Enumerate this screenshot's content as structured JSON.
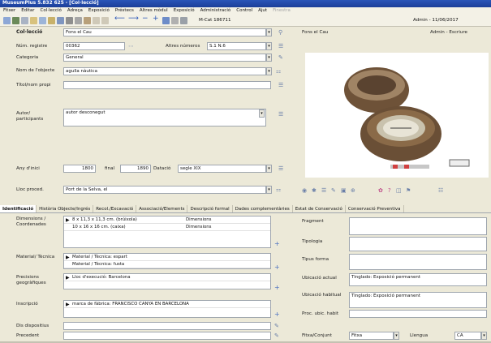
{
  "window": {
    "title": "MuseumPlus 5.832 625 - [Col·lecció]"
  },
  "menu": [
    "Fitxer",
    "Editar",
    "Col·lecció",
    "Adreça",
    "Exposició",
    "Préstecs",
    "Altres mòdul",
    "Exposició",
    "Administració",
    "Control",
    "Ajut"
  ],
  "menu_dim": "Finestra",
  "toolbar": {
    "record": "M-Cat 186711",
    "user_date": "Admin - 11/06/2017"
  },
  "header": {
    "label": "Col·lecció",
    "collection": "Fons el Cau",
    "right_collection": "Fons el Cau",
    "right_user": "Admin - Escriure"
  },
  "fields": {
    "num_registre_label": "Núm. registre",
    "num_registre": "00362",
    "altres_numeros_label": "Altres números",
    "altres_numeros": "S.1 N.6",
    "categoria_label": "Categoria",
    "categoria": "General",
    "nom_objecte_label": "Nom de l'objecte",
    "nom_objecte": "agulla nàutica",
    "titol_label": "Títol/nom propi",
    "titol": "",
    "autor_label": "Autor/ participants",
    "autor": "autor desconegut",
    "any_label": "Any d'inici",
    "any_inici": "1800",
    "final_label": "final",
    "any_final": "1890",
    "datacio_label": "Datació",
    "datacio": "segle XIX",
    "lloc_label": "Lloc proced.",
    "lloc": "Port de la Selva, el"
  },
  "tabs": [
    "Identificació",
    "Història Objecte/Ingrés",
    "Recol./Excavació",
    "Associació/Elements",
    "Descripció formal",
    "Dades complementàries",
    "Estat de Conservació",
    "Conservació Preventiva"
  ],
  "lower_left": {
    "dimensions_label": "Dimensions / Coordenades",
    "dim_rows": [
      {
        "value": "8 x 11,3 x 11,3 cm. (brúixola)",
        "type": "Dimensions"
      },
      {
        "value": "10 x 16 x 16 cm. (caixa)",
        "type": "Dimensions"
      }
    ],
    "material_label": "Material/ Tècnica",
    "material_rows": [
      "Material / Tècnica: espart",
      "Material / Tècnica: fusta"
    ],
    "precisions_label": "Precisions geogràfiques",
    "precisions_row": "Lloc d'execució: Barcelona",
    "inscripcions_label": "Inscripció",
    "inscripcions_row": "marca de fàbrica: FRANCISCO CANYA EN BARCELONA",
    "dispositiu_label": "Dis dispositius",
    "precedent_label": "Precedent"
  },
  "lower_right": {
    "fragment_label": "Fragment",
    "tipologia_label": "Tipologia",
    "tipus_forma_label": "Tipus forma",
    "ubicacio_actual_label": "Ubicació actual",
    "ubicacio_actual": "Tinglado: Exposició permanent",
    "ubicacio_habitual_label": "Ubicació habitual",
    "ubicacio_habitual": "Tinglado: Exposició permanent",
    "proc_label": "Proc. ubic. habit",
    "fitxa_label": "Fitxa/Conjunt",
    "fitxa": "Fitxa",
    "llengua_label": "Llengua",
    "llengua": "CA"
  },
  "colors": {
    "title_bg": "#1c3f99",
    "window_bg": "#ece9d8",
    "field_border": "#9fa6ae"
  }
}
